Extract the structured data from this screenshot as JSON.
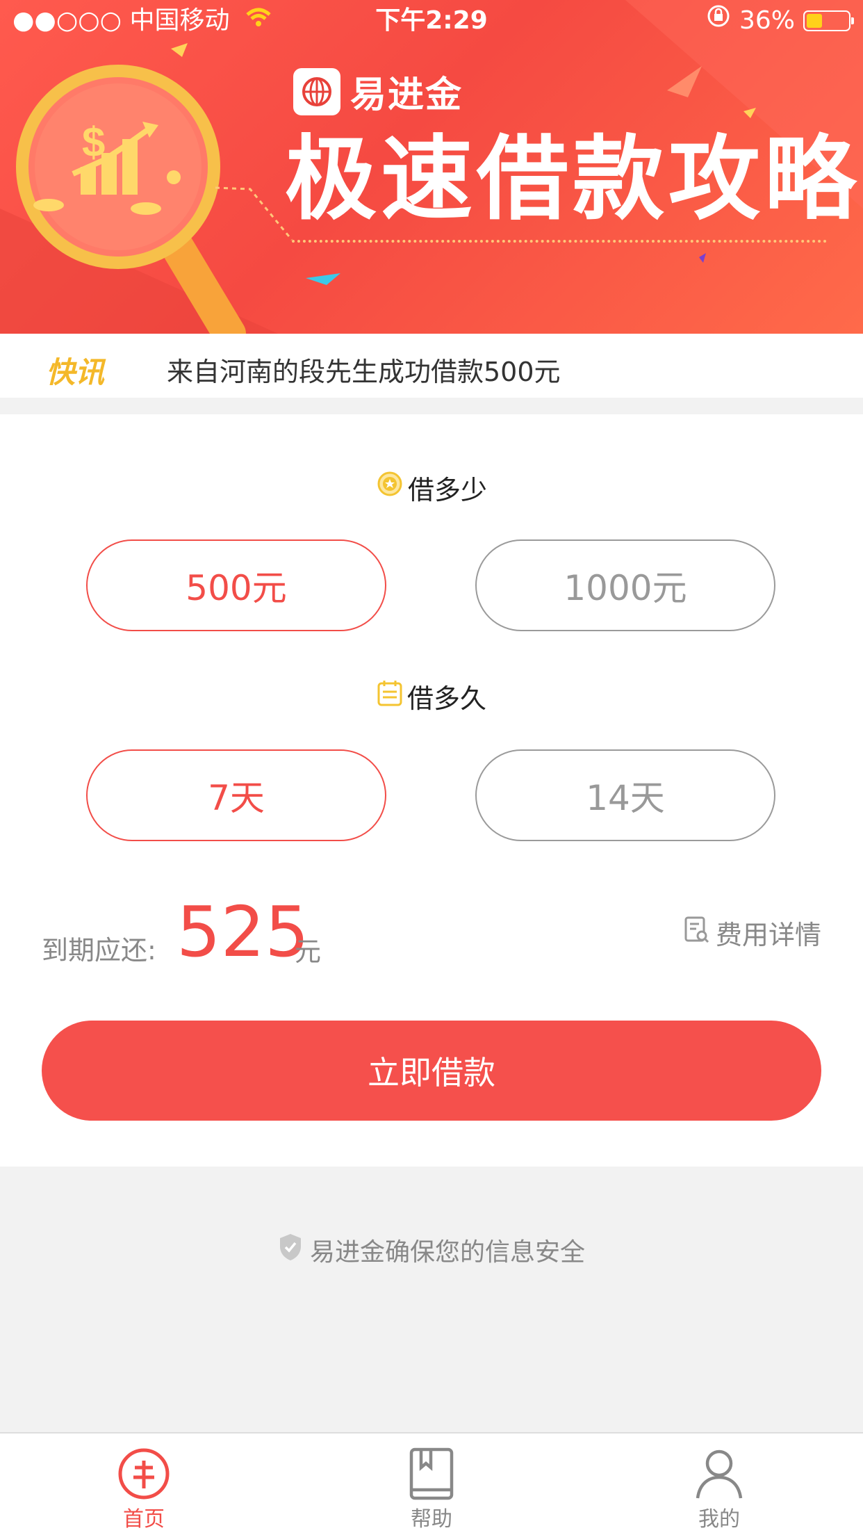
{
  "status_bar": {
    "carrier": "●●○○○ 中国移动",
    "time": "下午2:29",
    "battery": "36%"
  },
  "banner": {
    "brand_name": "易进金",
    "title": "极速借款攻略"
  },
  "news": {
    "tag": "快讯",
    "text": "来自河南的段先生成功借款500元"
  },
  "amount": {
    "label": "借多少",
    "options": [
      "500元",
      "1000元"
    ],
    "selected": "500元"
  },
  "duration": {
    "label": "借多久",
    "options": [
      "7天",
      "14天"
    ],
    "selected": "7天"
  },
  "due": {
    "label": "到期应还:",
    "amount": "525",
    "unit": "元",
    "fee_details": "费用详情"
  },
  "cta_label": "立即借款",
  "secure_text": "易进金确保您的信息安全",
  "tabs": [
    {
      "label": "首页",
      "icon": "home-coin-icon",
      "active": true
    },
    {
      "label": "帮助",
      "icon": "book-icon",
      "active": false
    },
    {
      "label": "我的",
      "icon": "user-icon",
      "active": false
    }
  ],
  "colors": {
    "accent": "#f24d48",
    "banner": "#f54a42",
    "gold": "#f4b829"
  }
}
